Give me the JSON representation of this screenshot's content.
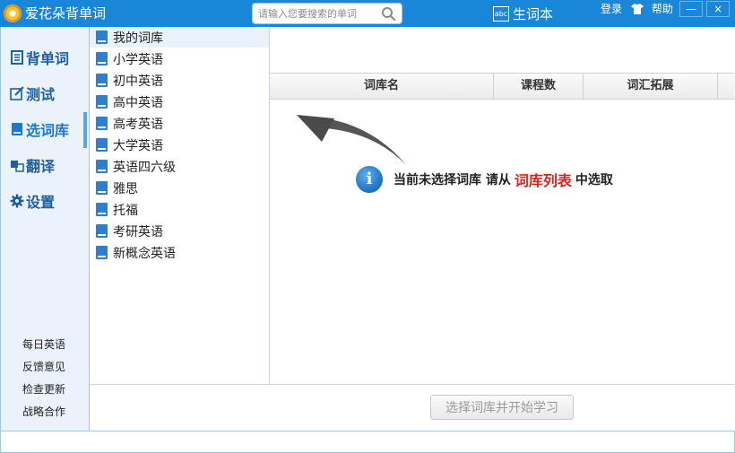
{
  "app": {
    "title": "爱花朵背单词"
  },
  "search": {
    "placeholder": "请输入您要搜索的单词"
  },
  "header": {
    "vocab_book": "生词本",
    "vocab_icon_text": "abc",
    "login": "登录",
    "help": "帮助",
    "minimize": "—",
    "close": "×"
  },
  "sidebar": {
    "nav": [
      {
        "label": "背单词",
        "icon": "card-icon"
      },
      {
        "label": "测试",
        "icon": "edit-icon"
      },
      {
        "label": "选词库",
        "icon": "book-icon",
        "active": true
      },
      {
        "label": "翻译",
        "icon": "translate-icon"
      },
      {
        "label": "设置",
        "icon": "gear-icon"
      }
    ],
    "links": [
      "每日英语",
      "反馈意见",
      "检查更新",
      "战略合作"
    ]
  },
  "libraries": [
    "我的词库",
    "小学英语",
    "初中英语",
    "高中英语",
    "高考英语",
    "大学英语",
    "英语四六级",
    "雅思",
    "托福",
    "考研英语",
    "新概念英语"
  ],
  "table": {
    "headers": [
      "词库名",
      "课程数",
      "词汇拓展"
    ]
  },
  "notice": {
    "prefix": "当前未选择词库  请从",
    "highlight": "词库列表",
    "suffix": "中选取"
  },
  "actions": {
    "start_label": "选择词库并开始学习"
  },
  "colors": {
    "title_bar": "#1a86d8",
    "accent_red": "#d9241c",
    "icon_blue": "#2d7fd1"
  }
}
